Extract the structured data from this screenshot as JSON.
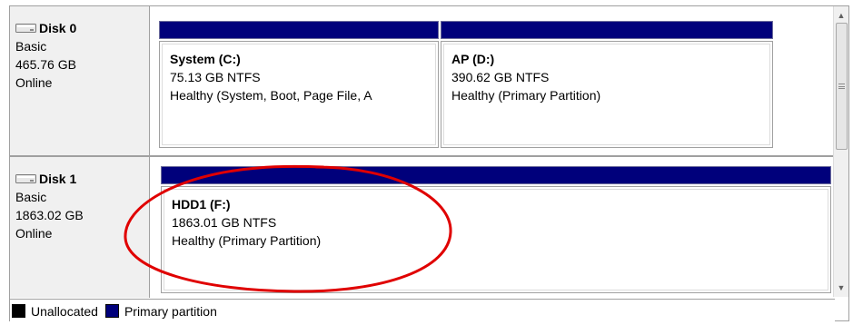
{
  "colors": {
    "primary_partition": "#00007b",
    "unallocated": "#000000",
    "annotation": "#e00000"
  },
  "disks": [
    {
      "name": "Disk 0",
      "icon": "disk-drive-icon",
      "type": "Basic",
      "size": "465.76 GB",
      "status": "Online",
      "partitions": [
        {
          "title": "System  (C:)",
          "size_fs": "75.13 GB NTFS",
          "status": "Healthy (System, Boot, Page File, A"
        },
        {
          "title": "AP  (D:)",
          "size_fs": "390.62 GB NTFS",
          "status": "Healthy (Primary Partition)"
        }
      ]
    },
    {
      "name": "Disk 1",
      "icon": "disk-drive-icon",
      "type": "Basic",
      "size": "1863.02 GB",
      "status": "Online",
      "partitions": [
        {
          "title": "HDD1  (F:)",
          "size_fs": "1863.01 GB NTFS",
          "status": "Healthy (Primary Partition)"
        }
      ]
    }
  ],
  "legend": [
    {
      "label": "Unallocated",
      "color": "#000000"
    },
    {
      "label": "Primary partition",
      "color": "#00007b"
    }
  ]
}
